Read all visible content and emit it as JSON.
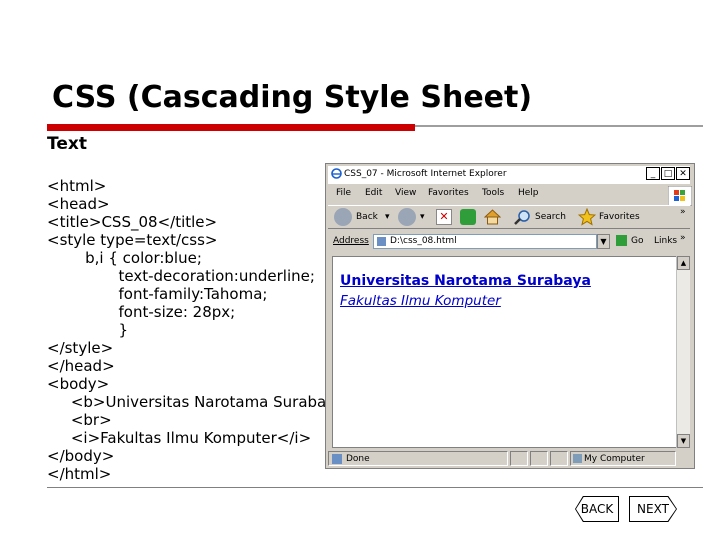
{
  "slide": {
    "title": "CSS (Cascading Style Sheet)",
    "subtitle": "Text",
    "code_lines": [
      "<html>",
      "<head>",
      "<title>CSS_08</title>",
      "<style type=text/css>",
      "        b,i { color:blue;",
      "               text-decoration:underline;",
      "               font-family:Tahoma;",
      "               font-size: 28px;",
      "               }",
      "</style>",
      "</head>",
      "<body>",
      "     <b>Universitas Narotama Surabaya</b>",
      "     <br>",
      "     <i>Fakultas Ilmu Komputer</i>",
      "</body>",
      "</html>"
    ]
  },
  "browser": {
    "window_title": "CSS_07 - Microsoft Internet Explorer",
    "menu": [
      "File",
      "Edit",
      "View",
      "Favorites",
      "Tools",
      "Help"
    ],
    "toolbar": {
      "back": "Back",
      "search": "Search",
      "favorites": "Favorites"
    },
    "address_label": "Address",
    "address_value": "D:\\css_08.html",
    "go_label": "Go",
    "links_label": "Links",
    "content": {
      "bold_text": "Universitas Narotama Surabaya",
      "italic_text": "Fakultas Ilmu Komputer"
    },
    "status_done": "Done",
    "status_zone": "My Computer"
  },
  "nav": {
    "back": "BACK",
    "next": "NEXT"
  },
  "colors": {
    "accent_red": "#cc0000",
    "link_blue": "#0000cc"
  }
}
